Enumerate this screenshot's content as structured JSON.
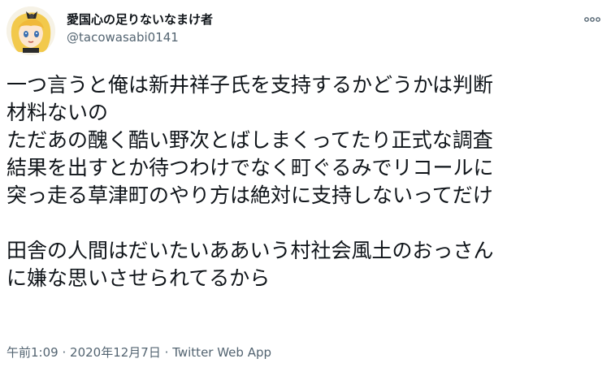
{
  "tweet": {
    "author": {
      "display_name": "愛国心の足りないなまけ者",
      "handle": "@tacowasabi0141",
      "avatar_icon": "anime-avatar"
    },
    "more_icon": "more-options-icon",
    "text": "一つ言うと俺は新井祥子氏を支持するかどうかは判断\n材料ないの\nただあの醜く酷い野次とばしまくってたり正式な調査\n結果を出すとか待つわけでなく町ぐるみでリコールに\n突っ走る草津町のやり方は絶対に支持しないってだけ\n\n田舎の人間はだいたいああいう村社会風土のおっさん\nに嫌な思いさせられてるから",
    "time": "午前1:09",
    "separator": "·",
    "date": "2020年12月7日",
    "client": "Twitter Web App"
  },
  "colors": {
    "text": "#0f1419",
    "secondary": "#536471",
    "avatar_hair": "#f2c94c",
    "avatar_bow": "#2b2b2b"
  }
}
